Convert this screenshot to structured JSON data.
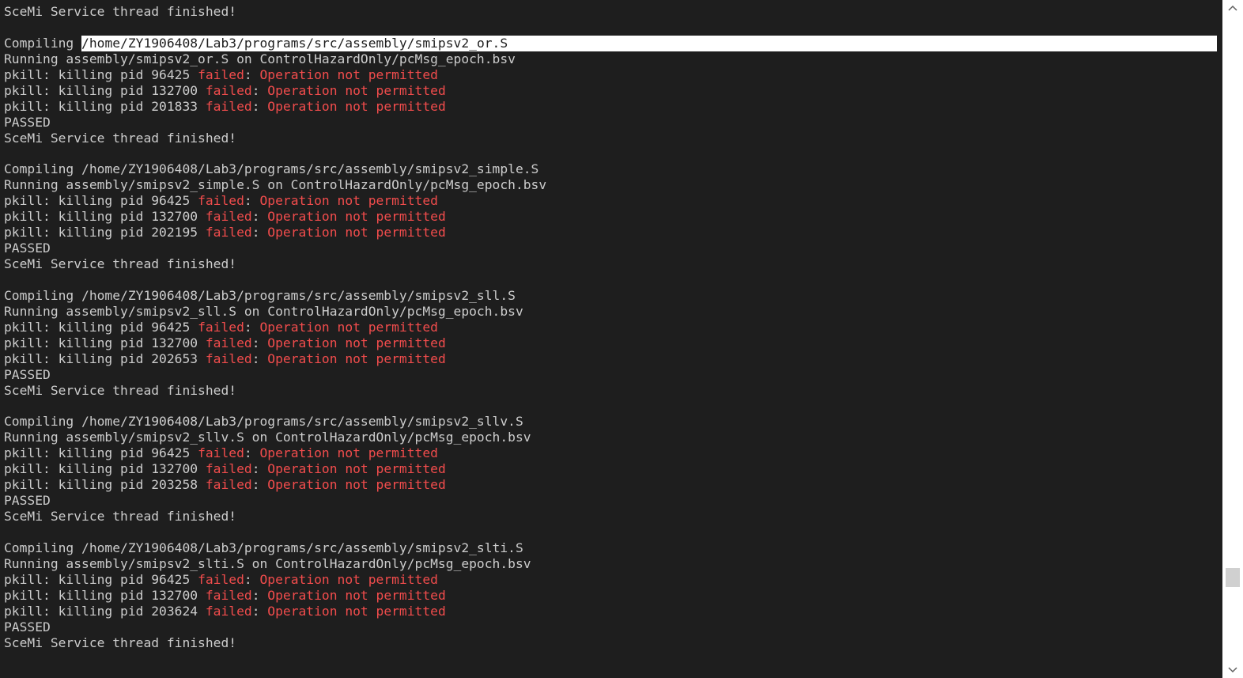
{
  "terminal": {
    "colors": {
      "background": "#1e1e1e",
      "foreground": "#cccccc",
      "error": "#f14c4c",
      "selection": "#ffffff"
    },
    "scroll_position": 0.88,
    "lines": [
      [
        {
          "t": "SceMi Service thread finished!"
        }
      ],
      [],
      [
        {
          "t": "Compiling "
        },
        {
          "t": "/home/ZY1906408/Lab3/programs/src/assembly/smipsv2_or.S",
          "s": "sel"
        }
      ],
      [
        {
          "t": "Running assembly/smipsv2_or.S on ControlHazardOnly/pcMsg_epoch.bsv"
        }
      ],
      [
        {
          "t": "pkill: killing pid 96425 "
        },
        {
          "t": "failed",
          "s": "red"
        },
        {
          "t": ": "
        },
        {
          "t": "Operation not permitted",
          "s": "red"
        }
      ],
      [
        {
          "t": "pkill: killing pid 132700 "
        },
        {
          "t": "failed",
          "s": "red"
        },
        {
          "t": ": "
        },
        {
          "t": "Operation not permitted",
          "s": "red"
        }
      ],
      [
        {
          "t": "pkill: killing pid 201833 "
        },
        {
          "t": "failed",
          "s": "red"
        },
        {
          "t": ": "
        },
        {
          "t": "Operation not permitted",
          "s": "red"
        }
      ],
      [
        {
          "t": "PASSED"
        }
      ],
      [
        {
          "t": "SceMi Service thread finished!"
        }
      ],
      [],
      [
        {
          "t": "Compiling /home/ZY1906408/Lab3/programs/src/assembly/smipsv2_simple.S"
        }
      ],
      [
        {
          "t": "Running assembly/smipsv2_simple.S on ControlHazardOnly/pcMsg_epoch.bsv"
        }
      ],
      [
        {
          "t": "pkill: killing pid 96425 "
        },
        {
          "t": "failed",
          "s": "red"
        },
        {
          "t": ": "
        },
        {
          "t": "Operation not permitted",
          "s": "red"
        }
      ],
      [
        {
          "t": "pkill: killing pid 132700 "
        },
        {
          "t": "failed",
          "s": "red"
        },
        {
          "t": ": "
        },
        {
          "t": "Operation not permitted",
          "s": "red"
        }
      ],
      [
        {
          "t": "pkill: killing pid 202195 "
        },
        {
          "t": "failed",
          "s": "red"
        },
        {
          "t": ": "
        },
        {
          "t": "Operation not permitted",
          "s": "red"
        }
      ],
      [
        {
          "t": "PASSED"
        }
      ],
      [
        {
          "t": "SceMi Service thread finished!"
        }
      ],
      [],
      [
        {
          "t": "Compiling /home/ZY1906408/Lab3/programs/src/assembly/smipsv2_sll.S"
        }
      ],
      [
        {
          "t": "Running assembly/smipsv2_sll.S on ControlHazardOnly/pcMsg_epoch.bsv"
        }
      ],
      [
        {
          "t": "pkill: killing pid 96425 "
        },
        {
          "t": "failed",
          "s": "red"
        },
        {
          "t": ": "
        },
        {
          "t": "Operation not permitted",
          "s": "red"
        }
      ],
      [
        {
          "t": "pkill: killing pid 132700 "
        },
        {
          "t": "failed",
          "s": "red"
        },
        {
          "t": ": "
        },
        {
          "t": "Operation not permitted",
          "s": "red"
        }
      ],
      [
        {
          "t": "pkill: killing pid 202653 "
        },
        {
          "t": "failed",
          "s": "red"
        },
        {
          "t": ": "
        },
        {
          "t": "Operation not permitted",
          "s": "red"
        }
      ],
      [
        {
          "t": "PASSED"
        }
      ],
      [
        {
          "t": "SceMi Service thread finished!"
        }
      ],
      [],
      [
        {
          "t": "Compiling /home/ZY1906408/Lab3/programs/src/assembly/smipsv2_sllv.S"
        }
      ],
      [
        {
          "t": "Running assembly/smipsv2_sllv.S on ControlHazardOnly/pcMsg_epoch.bsv"
        }
      ],
      [
        {
          "t": "pkill: killing pid 96425 "
        },
        {
          "t": "failed",
          "s": "red"
        },
        {
          "t": ": "
        },
        {
          "t": "Operation not permitted",
          "s": "red"
        }
      ],
      [
        {
          "t": "pkill: killing pid 132700 "
        },
        {
          "t": "failed",
          "s": "red"
        },
        {
          "t": ": "
        },
        {
          "t": "Operation not permitted",
          "s": "red"
        }
      ],
      [
        {
          "t": "pkill: killing pid 203258 "
        },
        {
          "t": "failed",
          "s": "red"
        },
        {
          "t": ": "
        },
        {
          "t": "Operation not permitted",
          "s": "red"
        }
      ],
      [
        {
          "t": "PASSED"
        }
      ],
      [
        {
          "t": "SceMi Service thread finished!"
        }
      ],
      [],
      [
        {
          "t": "Compiling /home/ZY1906408/Lab3/programs/src/assembly/smipsv2_slti.S"
        }
      ],
      [
        {
          "t": "Running assembly/smipsv2_slti.S on ControlHazardOnly/pcMsg_epoch.bsv"
        }
      ],
      [
        {
          "t": "pkill: killing pid 96425 "
        },
        {
          "t": "failed",
          "s": "red"
        },
        {
          "t": ": "
        },
        {
          "t": "Operation not permitted",
          "s": "red"
        }
      ],
      [
        {
          "t": "pkill: killing pid 132700 "
        },
        {
          "t": "failed",
          "s": "red"
        },
        {
          "t": ": "
        },
        {
          "t": "Operation not permitted",
          "s": "red"
        }
      ],
      [
        {
          "t": "pkill: killing pid 203624 "
        },
        {
          "t": "failed",
          "s": "red"
        },
        {
          "t": ": "
        },
        {
          "t": "Operation not permitted",
          "s": "red"
        }
      ],
      [
        {
          "t": "PASSED"
        }
      ],
      [
        {
          "t": "SceMi Service thread finished!"
        }
      ]
    ]
  },
  "scrollbar": {
    "up_icon": "chevron-up-icon",
    "down_icon": "chevron-down-icon"
  }
}
